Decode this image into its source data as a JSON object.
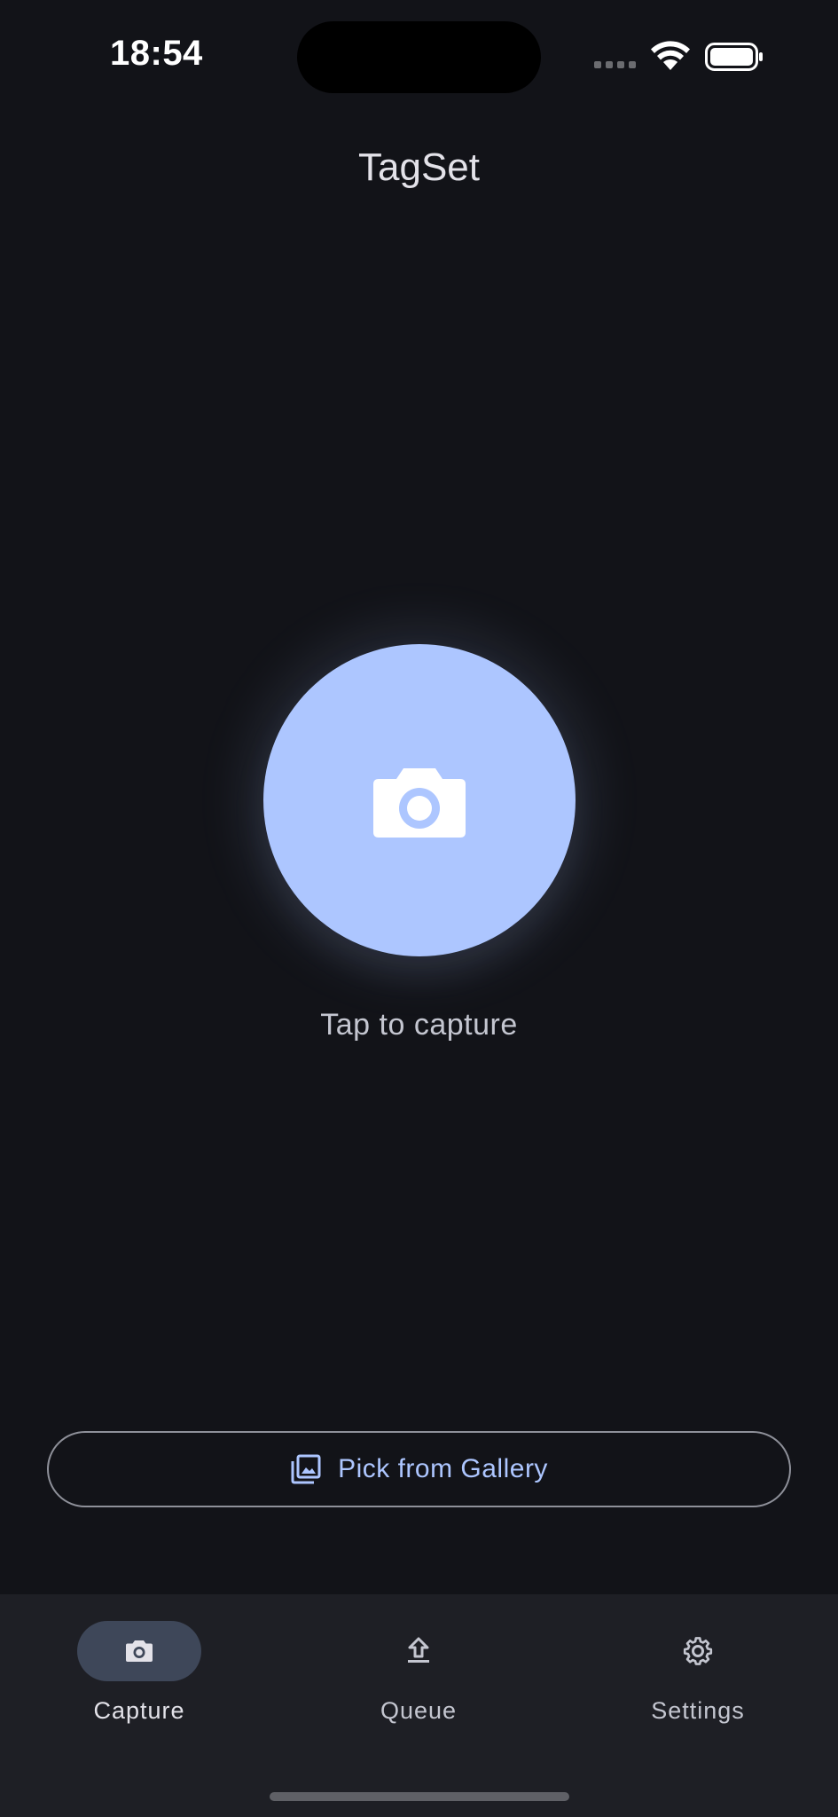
{
  "status_bar": {
    "time": "18:54"
  },
  "header": {
    "title": "TagSet"
  },
  "capture": {
    "hint": "Tap to capture",
    "icon": "camera-icon"
  },
  "gallery_button": {
    "label": "Pick from Gallery",
    "icon": "photo-library-icon"
  },
  "bottom_nav": {
    "items": [
      {
        "label": "Capture",
        "icon": "camera-icon",
        "selected": true
      },
      {
        "label": "Queue",
        "icon": "upload-icon",
        "selected": false
      },
      {
        "label": "Settings",
        "icon": "gear-icon",
        "selected": false
      }
    ]
  },
  "colors": {
    "background": "#121318",
    "primary": "#adc6ff",
    "nav_background": "#1e1f25",
    "nav_indicator": "#3e4759",
    "outline": "#8e9099"
  }
}
